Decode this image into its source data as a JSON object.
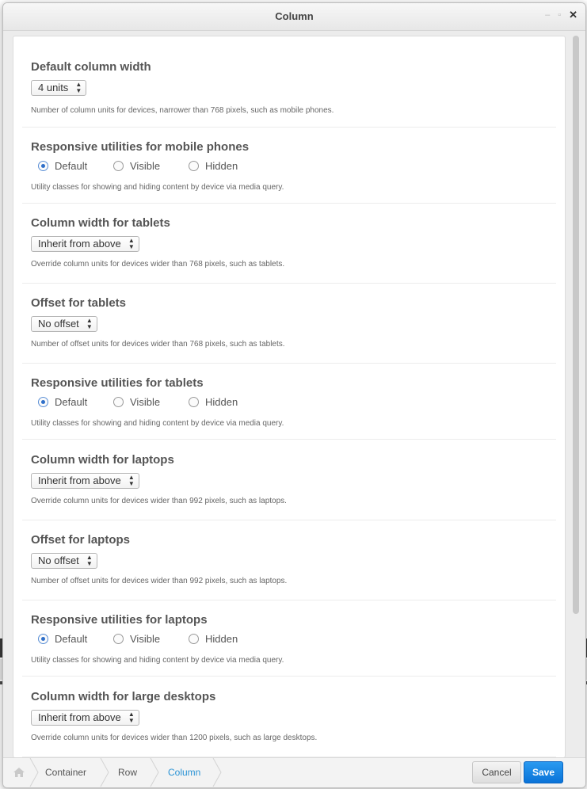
{
  "dialog": {
    "title": "Column"
  },
  "sections": [
    {
      "title": "Default column width",
      "select": "4 units",
      "help": "Number of column units for devices, narrower than 768 pixels, such as mobile phones."
    },
    {
      "title": "Responsive utilities for mobile phones",
      "radios": [
        "Default",
        "Visible",
        "Hidden"
      ],
      "checked": "Default",
      "help": "Utility classes for showing and hiding content by device via media query."
    },
    {
      "title": "Column width for tablets",
      "select": "Inherit from above",
      "help": "Override column units for devices wider than 768 pixels, such as tablets."
    },
    {
      "title": "Offset for tablets",
      "select": "No offset",
      "help": "Number of offset units for devices wider than 768 pixels, such as tablets."
    },
    {
      "title": "Responsive utilities for tablets",
      "radios": [
        "Default",
        "Visible",
        "Hidden"
      ],
      "checked": "Default",
      "help": "Utility classes for showing and hiding content by device via media query."
    },
    {
      "title": "Column width for laptops",
      "select": "Inherit from above",
      "help": "Override column units for devices wider than 992 pixels, such as laptops."
    },
    {
      "title": "Offset for laptops",
      "select": "No offset",
      "help": "Number of offset units for devices wider than 992 pixels, such as laptops."
    },
    {
      "title": "Responsive utilities for laptops",
      "radios": [
        "Default",
        "Visible",
        "Hidden"
      ],
      "checked": "Default",
      "help": "Utility classes for showing and hiding content by device via media query."
    },
    {
      "title": "Column width for large desktops",
      "select": "Inherit from above",
      "help": "Override column units for devices wider than 1200 pixels, such as large desktops."
    }
  ],
  "breadcrumb": [
    "Container",
    "Row",
    "Column"
  ],
  "footer": {
    "cancel": "Cancel",
    "save": "Save"
  },
  "colors": {
    "accent": "#1585e6",
    "breadcrumb_active": "#2a93d5",
    "radio_checked": "#2f6fc9"
  }
}
